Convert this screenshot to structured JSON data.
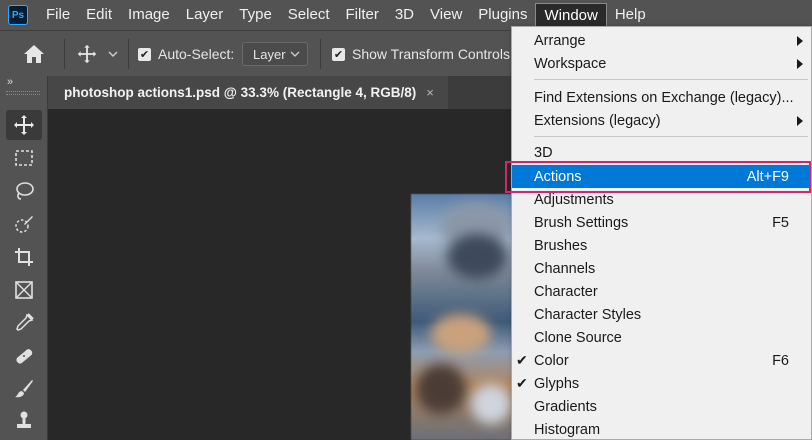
{
  "app": {
    "logo_text": "Ps"
  },
  "menubar": {
    "items": [
      "File",
      "Edit",
      "Image",
      "Layer",
      "Type",
      "Select",
      "Filter",
      "3D",
      "View",
      "Plugins",
      "Window",
      "Help"
    ],
    "active": "Window"
  },
  "options": {
    "auto_select_label": "Auto-Select:",
    "auto_select_checked": true,
    "target_value": "Layer",
    "show_transform_label": "Show Transform Controls",
    "show_transform_checked": true
  },
  "toolbar": {
    "collapse_glyph": "»",
    "tools": [
      "move-tool",
      "marquee-tool",
      "lasso-tool",
      "quick-selection-tool",
      "crop-tool",
      "frame-tool",
      "eyedropper-tool",
      "healing-brush-tool",
      "brush-tool",
      "clone-stamp-tool"
    ],
    "selected": "move-tool"
  },
  "document": {
    "tab_title": "photoshop actions1.psd @ 33.3% (Rectangle 4, RGB/8)",
    "close_glyph": "×"
  },
  "window_menu": {
    "items": [
      {
        "label": "Arrange",
        "submenu": true
      },
      {
        "label": "Workspace",
        "submenu": true
      },
      {
        "label": "Find Extensions on Exchange (legacy)..."
      },
      {
        "label": "Extensions (legacy)",
        "submenu": true
      },
      {
        "label": "3D"
      },
      {
        "label": "Actions",
        "shortcut": "Alt+F9",
        "highlighted": true
      },
      {
        "label": "Adjustments"
      },
      {
        "label": "Brush Settings",
        "shortcut": "F5"
      },
      {
        "label": "Brushes"
      },
      {
        "label": "Channels"
      },
      {
        "label": "Character"
      },
      {
        "label": "Character Styles"
      },
      {
        "label": "Clone Source"
      },
      {
        "label": "Color",
        "shortcut": "F6",
        "checked": true
      },
      {
        "label": "Glyphs",
        "checked": true
      },
      {
        "label": "Gradients"
      },
      {
        "label": "Histogram"
      }
    ],
    "check_glyph": "✔"
  },
  "colors": {
    "highlight": "#0078d7",
    "callout_border": "#d6246e",
    "ui_gray": "#535353"
  }
}
